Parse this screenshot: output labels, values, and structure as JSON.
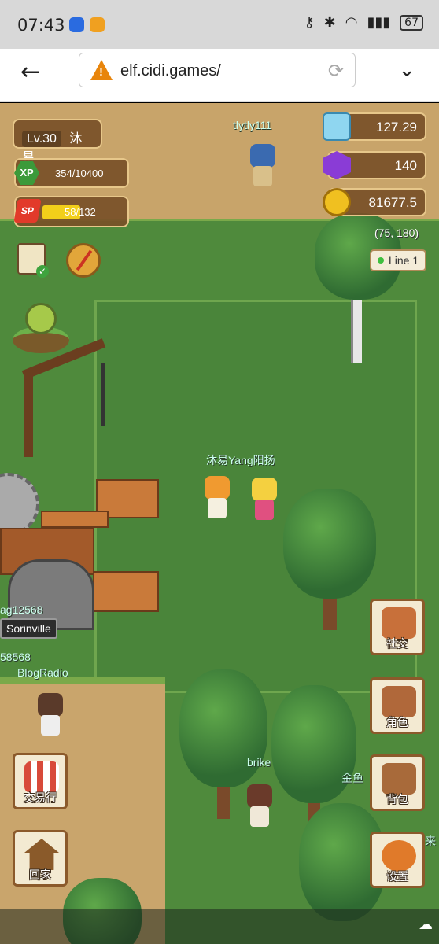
{
  "status_bar": {
    "time": "07:43",
    "battery": "67",
    "icons": [
      "bulb-app-icon",
      "orange-app-icon",
      "key-icon",
      "bluetooth-icon",
      "wifi-icon",
      "signal-icon",
      "battery-icon"
    ]
  },
  "browser": {
    "url": "elf.cidi.games/",
    "back_icon": "back-arrow-icon",
    "warning_icon": "not-secure-warning-icon",
    "reload_icon": "reload-icon",
    "menu_icon": "chevron-down-icon"
  },
  "player": {
    "level": "Lv.30",
    "name": "沐易",
    "xp": "354/10400",
    "xp_label": "XP",
    "sp": "58/132",
    "sp_label": "SP",
    "sp_fraction": 0.44
  },
  "resources": {
    "diamond": "127.29",
    "gem": "140",
    "coin": "81677.5"
  },
  "map": {
    "coords": "(75, 180)",
    "line": "Line 1"
  },
  "characters": {
    "top_player": "tlytly111",
    "party_name": "沐易Yang阳扬",
    "left_1": "ag12568",
    "left_2": "58568",
    "left_3": "BlogRadio",
    "brike": "brike",
    "gold": "金鱼",
    "right_cut": "来"
  },
  "place": {
    "label": "Sorinville"
  },
  "buttons": {
    "social": "社交",
    "character": "角色",
    "bag": "背包",
    "settings": "设置",
    "market": "交易行",
    "home": "回家"
  },
  "colors": {
    "hud_bg": "#7a5028",
    "hud_border": "#e7c78a",
    "grass": "#4f8a3c",
    "path": "#c8a46a",
    "sp_fill": "#f2cf1a",
    "xp_badge": "#3c9a3a"
  }
}
